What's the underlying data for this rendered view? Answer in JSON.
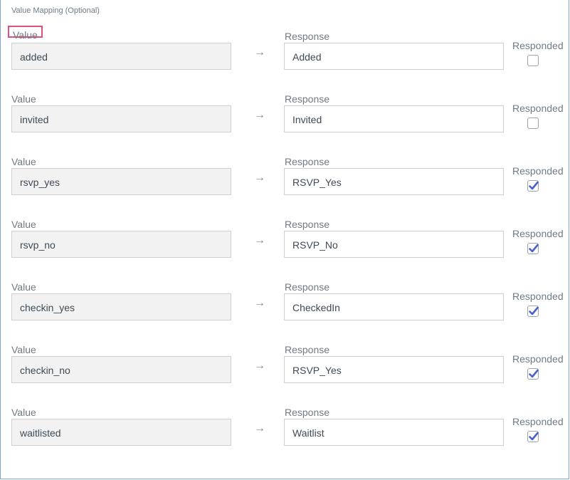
{
  "section_title": "Value Mapping (Optional)",
  "labels": {
    "value": "Value",
    "response": "Response",
    "responded": "Responded"
  },
  "arrow_glyph": "→",
  "rows": [
    {
      "value": "added",
      "response": "Added",
      "responded": false
    },
    {
      "value": "invited",
      "response": "Invited",
      "responded": false
    },
    {
      "value": "rsvp_yes",
      "response": "RSVP_Yes",
      "responded": true
    },
    {
      "value": "rsvp_no",
      "response": "RSVP_No",
      "responded": true
    },
    {
      "value": "checkin_yes",
      "response": "CheckedIn",
      "responded": true
    },
    {
      "value": "checkin_no",
      "response": "RSVP_Yes",
      "responded": true
    },
    {
      "value": "waitlisted",
      "response": "Waitlist",
      "responded": true
    }
  ],
  "colors": {
    "check": "#4a5fd8",
    "highlight": "#e0517a",
    "border": "#7ea6d6"
  }
}
